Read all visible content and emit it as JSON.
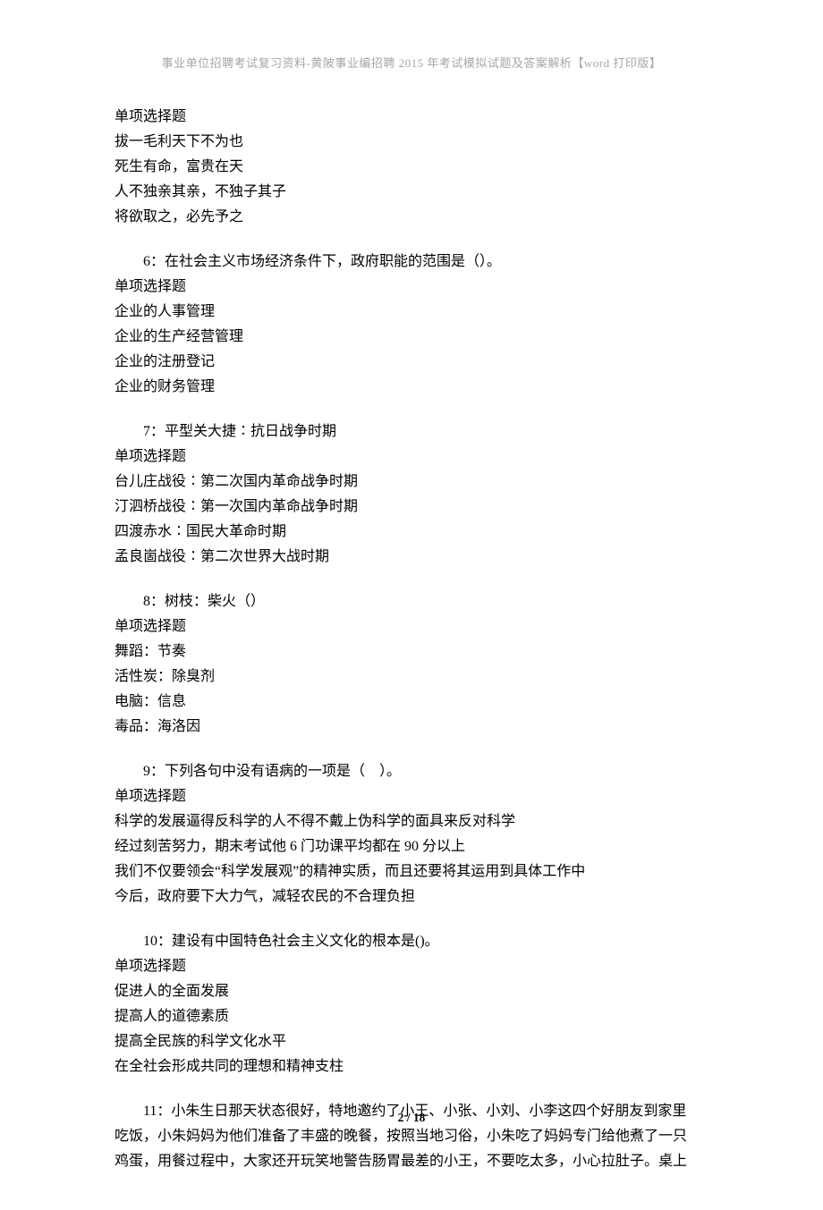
{
  "header": "事业单位招聘考试复习资料-黄陂事业编招聘 2015 年考试模拟试题及答案解析【word 打印版】",
  "page_number": "2 / 18",
  "blocks": [
    {
      "type": "options_only",
      "qtype": "单项选择题",
      "options": [
        "拔一毛利天下不为也",
        "死生有命，富贵在天",
        "人不独亲其亲，不独子其子",
        "将欲取之，必先予之"
      ]
    },
    {
      "type": "question",
      "title": "6：在社会主义市场经济条件下，政府职能的范围是（）。",
      "qtype": "单项选择题",
      "options": [
        "企业的人事管理",
        "企业的生产经营管理",
        "企业的注册登记",
        "企业的财务管理"
      ]
    },
    {
      "type": "question",
      "title": "7：平型关大捷∶抗日战争时期",
      "qtype": "单项选择题",
      "options": [
        "台儿庄战役∶第二次国内革命战争时期",
        "汀泗桥战役∶第一次国内革命战争时期",
        "四渡赤水∶国民大革命时期",
        "孟良崮战役∶第二次世界大战时期"
      ]
    },
    {
      "type": "question",
      "title": "8：树枝：柴火（）",
      "qtype": "单项选择题",
      "options": [
        "舞蹈：节奏",
        "活性炭：除臭剂",
        "电脑：信息",
        "毒品：海洛因"
      ]
    },
    {
      "type": "question",
      "title": "9：下列各句中没有语病的一项是（　）。",
      "qtype": "单项选择题",
      "options": [
        "科学的发展逼得反科学的人不得不戴上伪科学的面具来反对科学",
        "经过刻苦努力，期末考试他 6 门功课平均都在 90 分以上",
        "我们不仅要领会“科学发展观”的精神实质，而且还要将其运用到具体工作中",
        "今后，政府要下大力气，减轻农民的不合理负担"
      ]
    },
    {
      "type": "question",
      "title": "10：建设有中国特色社会主义文化的根本是()。",
      "qtype": "单项选择题",
      "options": [
        "促进人的全面发展",
        "提高人的道德素质",
        "提高全民族的科学文化水平",
        "在全社会形成共同的理想和精神支柱"
      ]
    },
    {
      "type": "paragraph",
      "lines": [
        "11：小朱生日那天状态很好，特地邀约了小王、小张、小刘、小李这四个好朋友到家里",
        "吃饭，小朱妈妈为他们准备了丰盛的晚餐，按照当地习俗，小朱吃了妈妈专门给他煮了一只",
        "鸡蛋，用餐过程中，大家还开玩笑地警告肠胃最差的小王，不要吃太多，小心拉肚子。桌上"
      ]
    }
  ]
}
